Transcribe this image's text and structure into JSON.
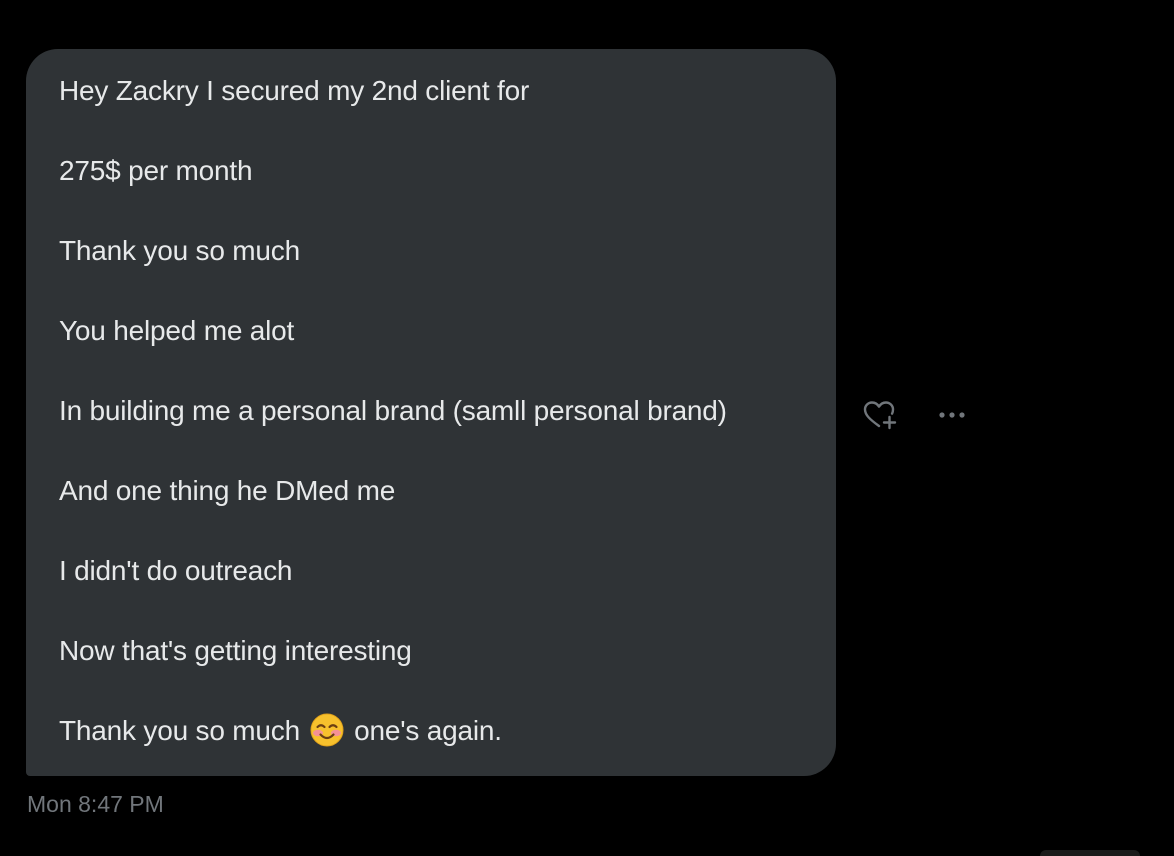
{
  "message": {
    "lines": [
      "Hey Zackry I secured my 2nd client for",
      "275$ per month",
      "Thank you so much",
      "You helped me alot",
      "In building me a personal brand (samll personal brand)",
      "And one thing he DMed me",
      "I didn't do outreach",
      "Now that's getting interesting"
    ],
    "last_line_before_emoji": "Thank you so much",
    "last_line_after_emoji": "one's again.",
    "emoji_icon": "smiling-face-with-blush-icon",
    "timestamp": "Mon 8:47 PM"
  },
  "actions": {
    "react_icon": "heart-plus-icon",
    "more_icon": "ellipsis-icon"
  },
  "colors": {
    "background": "#000000",
    "bubble": "#2f3336",
    "text": "#e7e9ea",
    "muted": "#71767b"
  }
}
